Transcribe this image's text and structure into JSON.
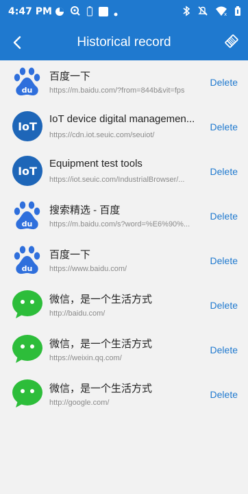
{
  "status_bar": {
    "time": "4:47 PM",
    "left_icons": [
      "record-icon",
      "search-status-icon",
      "battery-status-icon",
      "square-icon",
      "dot-icon"
    ],
    "right_icons": [
      "bluetooth-icon",
      "mute-icon",
      "wifi-icon",
      "battery-icon"
    ]
  },
  "app_bar": {
    "title": "Historical record",
    "back_icon": "chevron-left-icon",
    "clear_icon": "eraser-icon"
  },
  "colors": {
    "primary": "#1f79cf",
    "baidu": "#2f6fdc",
    "iot": "#1e66b8",
    "wechat": "#2dbd3a",
    "background": "#f2f2f2"
  },
  "records": [
    {
      "icon": "baidu-icon",
      "title": "百度一下",
      "url": "https://m.baidu.com/?from=844b&vit=fps",
      "delete_label": "Delete"
    },
    {
      "icon": "iot-icon",
      "title": "IoT device digital managemen...",
      "url": "https://cdn.iot.seuic.com/seuiot/",
      "delete_label": "Delete"
    },
    {
      "icon": "iot-icon",
      "title": "Equipment test tools",
      "url": "https://iot.seuic.com/IndustrialBrowser/...",
      "delete_label": "Delete"
    },
    {
      "icon": "baidu-icon",
      "title": "搜索精选 - 百度",
      "url": "https://m.baidu.com/s?word=%E6%90%...",
      "delete_label": "Delete"
    },
    {
      "icon": "baidu-icon",
      "title": "百度一下",
      "url": "https://www.baidu.com/",
      "delete_label": "Delete"
    },
    {
      "icon": "wechat-icon",
      "title": "微信，是一个生活方式",
      "url": "http://baidu.com/",
      "delete_label": "Delete"
    },
    {
      "icon": "wechat-icon",
      "title": "微信，是一个生活方式",
      "url": "https://weixin.qq.com/",
      "delete_label": "Delete"
    },
    {
      "icon": "wechat-icon",
      "title": "微信，是一个生活方式",
      "url": "http://google.com/",
      "delete_label": "Delete"
    }
  ]
}
